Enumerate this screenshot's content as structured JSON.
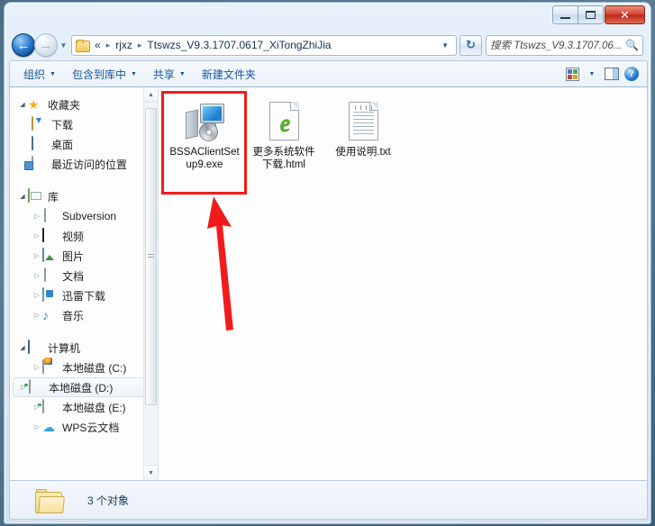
{
  "window": {
    "controls": {
      "minimize_label": "–",
      "maximize_label": "□",
      "close_label": "✕"
    }
  },
  "address_bar": {
    "back_label": "←",
    "forward_label": "→",
    "history_label": "▼",
    "crumbs": [
      {
        "label": "«",
        "is_overflow": true
      },
      {
        "label": "rjxz",
        "is_overflow": false
      },
      {
        "label": "Ttswzs_V9.3.1707.0617_XiTongZhiJia",
        "is_overflow": false
      }
    ],
    "separator": "▸",
    "dropdown_label": "▼",
    "refresh_label": "↻",
    "search_placeholder": "搜索 Ttswzs_V9.3.1707.06...",
    "search_value": "",
    "search_icon": "⌕"
  },
  "toolbar": {
    "items": [
      {
        "label": "组织",
        "has_caret": true
      },
      {
        "label": "包含到库中",
        "has_caret": true
      },
      {
        "label": "共享",
        "has_caret": true
      },
      {
        "label": "新建文件夹",
        "has_caret": false
      }
    ],
    "views_caret": "▼",
    "help_label": "?"
  },
  "sidebar": {
    "groups": [
      {
        "header": {
          "label": "收藏夹",
          "icon": "star-icon",
          "twisty": "◢"
        },
        "items": [
          {
            "label": "下载",
            "icon": "download-folder-icon",
            "twisty": ""
          },
          {
            "label": "桌面",
            "icon": "desktop-icon",
            "twisty": ""
          },
          {
            "label": "最近访问的位置",
            "icon": "recent-places-icon",
            "twisty": ""
          }
        ]
      },
      {
        "header": {
          "label": "库",
          "icon": "library-icon",
          "twisty": "◢"
        },
        "items": [
          {
            "label": "Subversion",
            "icon": "document-library-icon",
            "twisty": "▷"
          },
          {
            "label": "视频",
            "icon": "video-library-icon",
            "twisty": "▷"
          },
          {
            "label": "图片",
            "icon": "pictures-library-icon",
            "twisty": "▷"
          },
          {
            "label": "文档",
            "icon": "documents-library-icon",
            "twisty": "▷"
          },
          {
            "label": "迅雷下载",
            "icon": "xunlei-download-icon",
            "twisty": "▷"
          },
          {
            "label": "音乐",
            "icon": "music-library-icon",
            "twisty": "▷"
          }
        ]
      },
      {
        "header": {
          "label": "计算机",
          "icon": "computer-icon",
          "twisty": "◢"
        },
        "items": [
          {
            "label": "本地磁盘 (C:)",
            "icon": "system-drive-icon",
            "twisty": "▷",
            "selected": false
          },
          {
            "label": "本地磁盘 (D:)",
            "icon": "drive-icon",
            "twisty": "▷",
            "selected": true
          },
          {
            "label": "本地磁盘 (E:)",
            "icon": "drive-icon",
            "twisty": "▷",
            "selected": false
          },
          {
            "label": "WPS云文档",
            "icon": "cloud-icon",
            "twisty": "▷",
            "selected": false
          }
        ]
      }
    ],
    "scrollbar": {
      "up_label": "▲",
      "down_label": "▼"
    }
  },
  "files": [
    {
      "name": "BSSAClientSetup9.exe",
      "icon": "setup-exe-icon",
      "selected": false
    },
    {
      "name": "更多系统软件下载.html",
      "icon": "html-file-icon",
      "selected": false
    },
    {
      "name": "使用说明.txt",
      "icon": "text-file-icon",
      "selected": false
    }
  ],
  "status_bar": {
    "text": "3 个对象",
    "folder_icon": "folder-icon"
  },
  "annotation": {
    "highlight_color": "#f21b1b",
    "target": "BSSAClientSetup9.exe"
  }
}
